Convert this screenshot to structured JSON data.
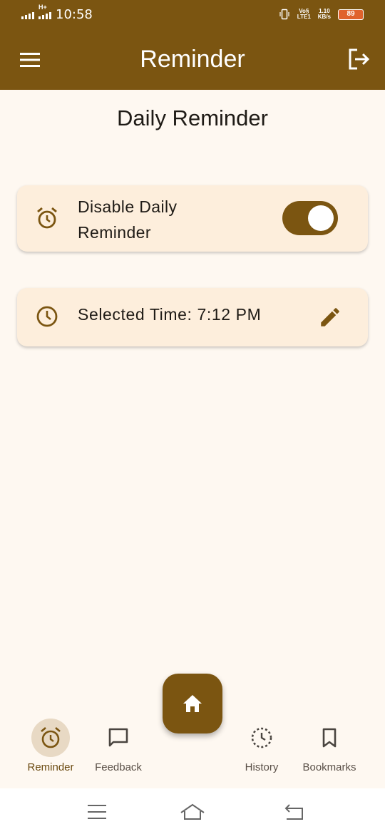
{
  "status_bar": {
    "time": "10:58",
    "network": "H+",
    "volte": [
      "Vo§",
      "LTE1"
    ],
    "speed": [
      "1.10",
      "KB/s"
    ],
    "battery": "89"
  },
  "app_bar": {
    "title": "Reminder"
  },
  "page": {
    "title": "Daily Reminder"
  },
  "daily_reminder_card": {
    "label": "Disable Daily Reminder",
    "toggle_on": true
  },
  "time_card": {
    "label": "Selected Time: 7:12 PM"
  },
  "bottom_nav": {
    "items": [
      {
        "label": "Reminder",
        "icon": "alarm-icon",
        "active": true
      },
      {
        "label": "Feedback",
        "icon": "chat-icon",
        "active": false
      },
      {
        "label": "History",
        "icon": "history-icon",
        "active": false
      },
      {
        "label": "Bookmarks",
        "icon": "bookmark-icon",
        "active": false
      }
    ],
    "fab_icon": "home-icon"
  },
  "colors": {
    "primary": "#7b5511",
    "background": "#fef8f1",
    "card": "#fdeedc",
    "active_pill": "#e8d9c4"
  }
}
